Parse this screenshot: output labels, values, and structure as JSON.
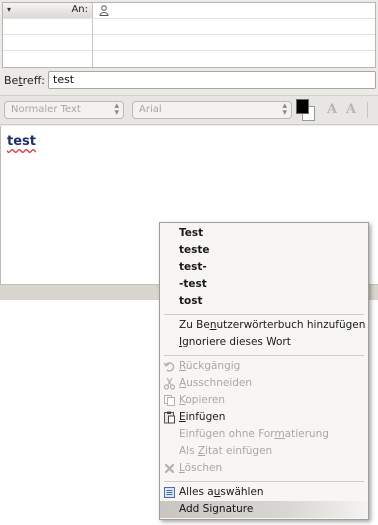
{
  "recipients": {
    "type_label": "An:",
    "type_arrow": "▾"
  },
  "subject": {
    "label_before": "Be",
    "label_mnemonic": "t",
    "label_after": "reff:",
    "value": "test"
  },
  "toolbar": {
    "paragraph_format": "Normaler Text",
    "font": "Arial",
    "bold_icon": "A",
    "italic_icon": "A"
  },
  "editor": {
    "text": "test"
  },
  "context_menu": {
    "suggestions": [
      "Test",
      "teste",
      "test-",
      "-test",
      "tost"
    ],
    "dictionary": {
      "add": [
        "Zu Be",
        "n",
        "utzerwörterbuch hinzufügen"
      ],
      "ignore": [
        "",
        "I",
        "gnoriere dieses Wort"
      ]
    },
    "edit": {
      "undo": [
        "",
        "R",
        "ückgängig"
      ],
      "cut": [
        "",
        "A",
        "usschneiden"
      ],
      "copy": [
        "",
        "K",
        "opieren"
      ],
      "paste": [
        "",
        "E",
        "infügen"
      ],
      "paste_plain": [
        "Einfügen ohne For",
        "m",
        "atierung"
      ],
      "paste_quote": [
        "Als ",
        "Z",
        "itat einfügen"
      ],
      "delete": [
        "",
        "L",
        "öschen"
      ]
    },
    "select_all": [
      "Alles a",
      "u",
      "swählen"
    ],
    "add_signature": "Add Signature"
  }
}
